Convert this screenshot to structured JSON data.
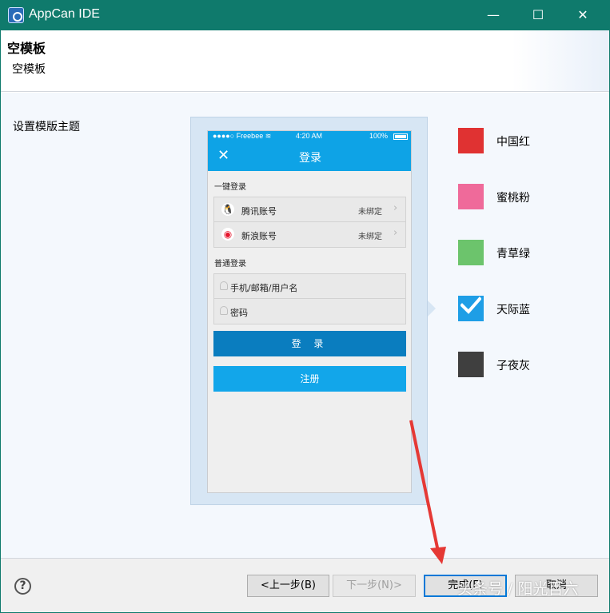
{
  "window": {
    "title": "AppCan IDE",
    "minimize": "—",
    "maximize": "☐",
    "close": "✕"
  },
  "header": {
    "title": "空模板",
    "subtitle": "空模板"
  },
  "content": {
    "theme_label": "设置模版主题"
  },
  "preview": {
    "status_carrier": "●●●●○ Freebee ≋",
    "status_time": "4:20 AM",
    "status_battery": "100%",
    "nav_close": "✕",
    "nav_title": "登录",
    "quick_login_label": "一键登录",
    "accounts": [
      {
        "icon": "qq-icon",
        "glyph": "🐧",
        "label": "腾讯账号",
        "status": "未绑定",
        "chevron": "›"
      },
      {
        "icon": "weibo-icon",
        "glyph": "◉",
        "label": "新浪账号",
        "status": "未绑定",
        "chevron": "›"
      }
    ],
    "normal_login_label": "普通登录",
    "username_placeholder": "手机/邮箱/用户名",
    "password_placeholder": "密码",
    "login_button": "登 录",
    "register_button": "注册"
  },
  "themes": [
    {
      "label": "中国红",
      "color": "#e03232",
      "selected": false
    },
    {
      "label": "蜜桃粉",
      "color": "#ef6a9a",
      "selected": false
    },
    {
      "label": "青草绿",
      "color": "#6cc46c",
      "selected": false
    },
    {
      "label": "天际蓝",
      "color": "#1e9ee6",
      "selected": true
    },
    {
      "label": "子夜灰",
      "color": "#3f3f3f",
      "selected": false
    }
  ],
  "footer": {
    "help": "?",
    "back": "<上一步(B)",
    "next": "下一步(N)>",
    "finish": "完成(F)",
    "cancel": "取消"
  },
  "watermark": "头条号 / 阳光百六",
  "colors": {
    "titlebar": "#0f7a6c",
    "accent": "#0ea3e6",
    "arrow": "#e53935"
  }
}
